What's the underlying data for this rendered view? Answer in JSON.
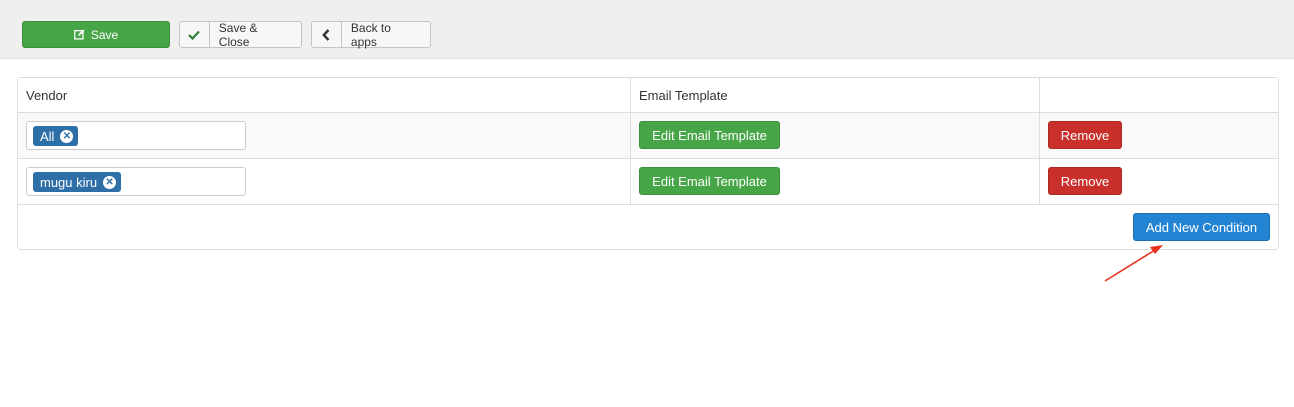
{
  "toolbar": {
    "save_label": "Save",
    "save_close_label": "Save & Close",
    "back_label": "Back to apps"
  },
  "table": {
    "headers": [
      "Vendor",
      "Email Template",
      ""
    ],
    "rows": [
      {
        "vendor_tag": "All",
        "edit_label": "Edit Email Template",
        "remove_label": "Remove"
      },
      {
        "vendor_tag": "mugu kiru",
        "edit_label": "Edit Email Template",
        "remove_label": "Remove"
      }
    ],
    "add_label": "Add New Condition"
  },
  "colors": {
    "green": "#46a546",
    "red": "#c9302c",
    "blue": "#2384d3",
    "tag": "#2f6fa7",
    "annotation_arrow": "#e8321e"
  },
  "icons": {
    "save": "edit-icon",
    "save_close": "check-icon",
    "back": "chevron-left-icon",
    "tag_remove": "close-circle-icon"
  }
}
